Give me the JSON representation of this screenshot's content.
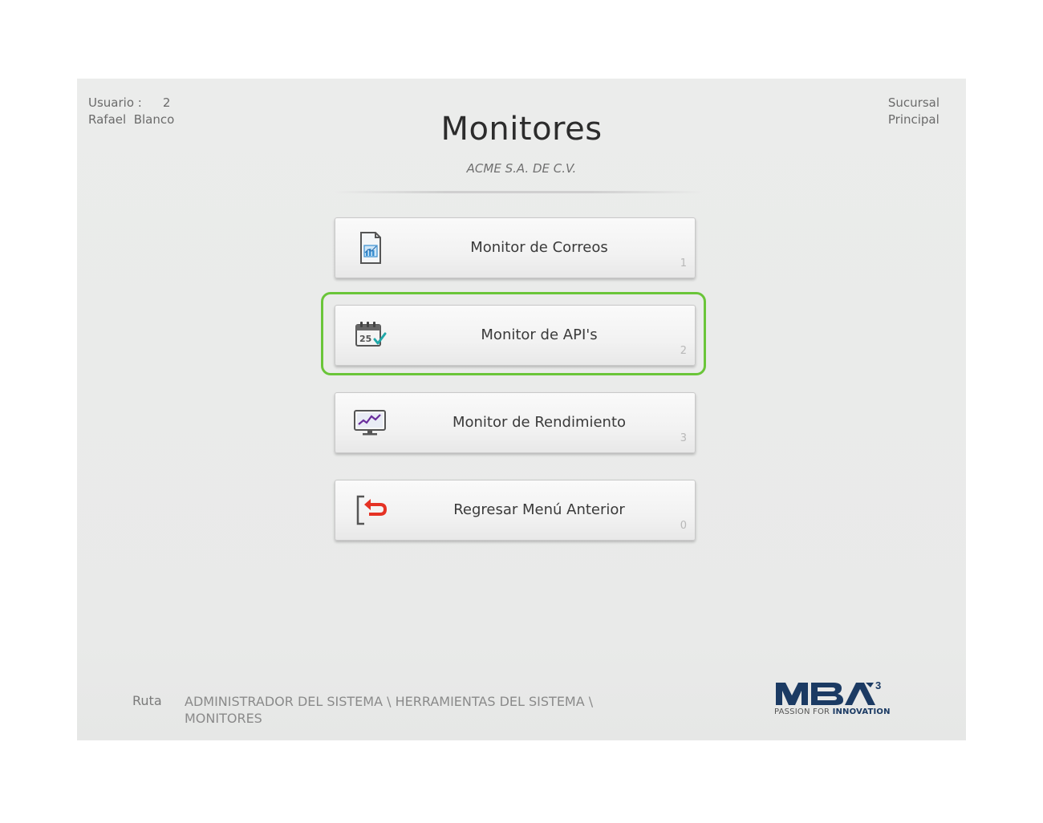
{
  "user": {
    "label": "Usuario :",
    "id": "2",
    "name": "Rafael  Blanco"
  },
  "branch": {
    "line1": "Sucursal",
    "line2": "Principal"
  },
  "header": {
    "title": "Monitores",
    "company": "ACME S.A. DE C.V."
  },
  "menu": {
    "items": [
      {
        "label": "Monitor de Correos",
        "key": "1",
        "icon": "report-chart-icon"
      },
      {
        "label": "Monitor de API's",
        "key": "2",
        "icon": "calendar-check-icon"
      },
      {
        "label": "Monitor de Rendimiento",
        "key": "3",
        "icon": "monitor-chart-icon"
      },
      {
        "label": "Regresar Menú Anterior",
        "key": "0",
        "icon": "exit-back-icon"
      }
    ],
    "selected_index": 1
  },
  "footer": {
    "route_label": "Ruta",
    "route_path": "ADMINISTRADOR DEL SISTEMA \\ HERRAMIENTAS DEL SISTEMA \\ MONITORES"
  },
  "logo": {
    "text": "MBA",
    "superscript": "3",
    "tagline_prefix": "PASSION FOR ",
    "tagline_bold": "INNOVATION",
    "color": "#1b3a63"
  },
  "colors": {
    "focus": "#6ac539",
    "background": "#ebeceb"
  }
}
